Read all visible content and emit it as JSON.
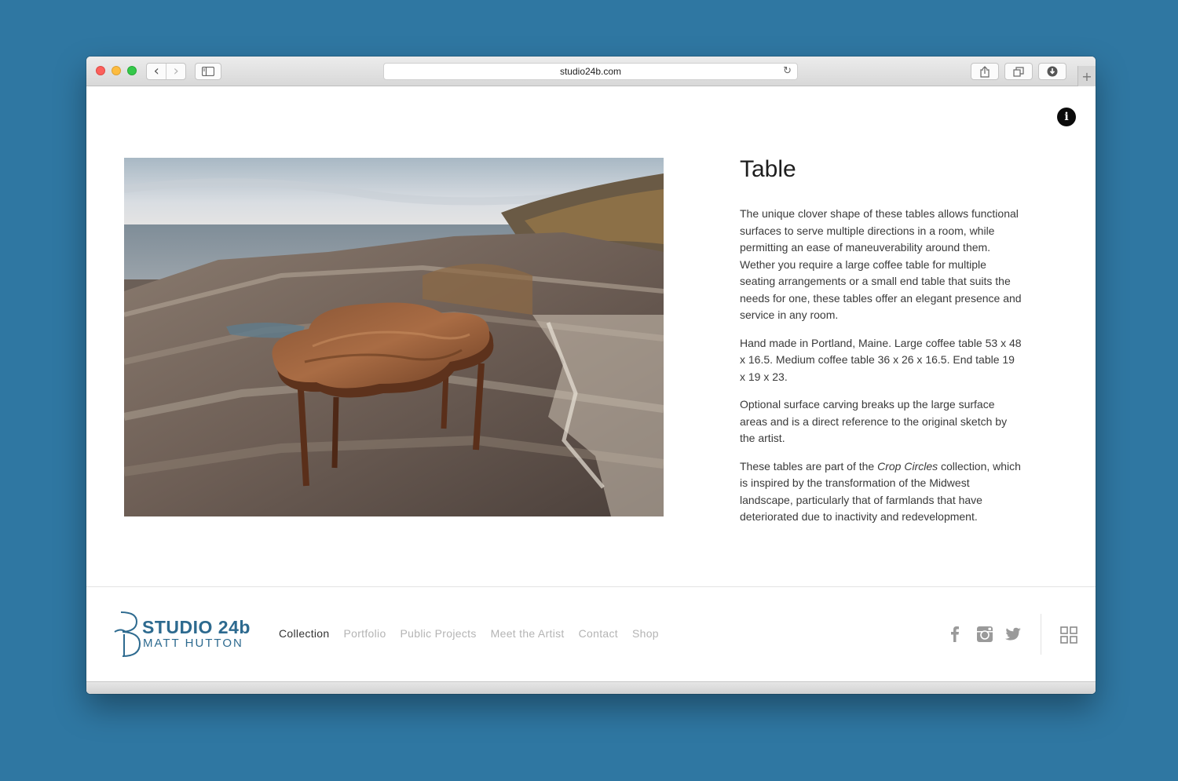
{
  "browser": {
    "url": "studio24b.com",
    "nav_back_glyph": "‹",
    "nav_forward_glyph": "›",
    "reload_glyph": "↻",
    "new_tab_glyph": "+"
  },
  "product": {
    "title": "Table",
    "paragraphs": [
      "The unique clover shape of these tables allows functional surfaces to serve multiple directions in a room, while permitting an ease of maneuverability around them. Wether you require a large coffee table for multiple seating arrangements or a small end table that suits the needs for one, these tables offer an elegant presence and service in any room.",
      "Hand made in Portland, Maine. Large coffee table 53 x 48 x 16.5. Medium coffee table 36 x 26 x 16.5. End table 19 x 19 x 23.",
      "Optional surface carving breaks up the large surface areas and is a direct reference to the original sketch by the artist."
    ],
    "collection_para": {
      "before": "These tables are part of the ",
      "em": "Crop Circles",
      "after": " collection, which is inspired by the transformation of the Midwest landscape, particularly that of farmlands that have deteriorated due to inactivity and redevelopment."
    }
  },
  "logo": {
    "main": "STUDIO 24b",
    "sub": "MATT HUTTON"
  },
  "nav": {
    "items": [
      "Collection",
      "Portfolio",
      "Public Projects",
      "Meet the Artist",
      "Contact",
      "Shop"
    ],
    "active_index": 0
  },
  "colors": {
    "background": "#2f77a2",
    "brand": "#2d6a8f",
    "nav_inactive": "#b4b4b4",
    "nav_active": "#333333",
    "social_icon": "#9a9a9a"
  },
  "icons": {
    "info": "info-icon",
    "facebook": "facebook-icon",
    "instagram": "instagram-icon",
    "twitter": "twitter-icon",
    "grid": "grid-icon"
  }
}
